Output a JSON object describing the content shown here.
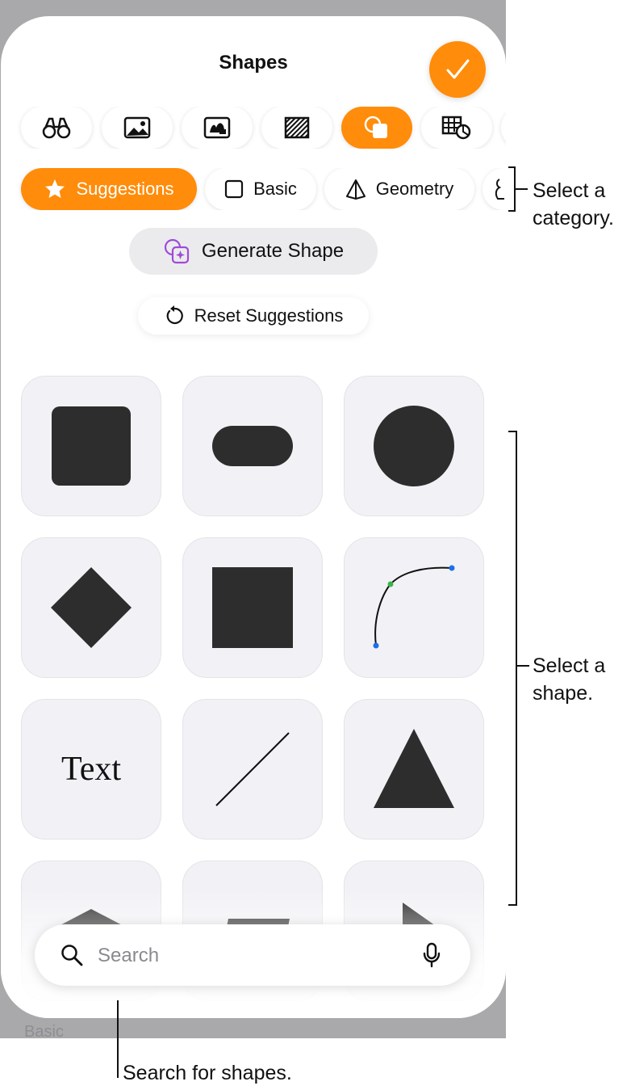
{
  "sheet": {
    "title": "Shapes",
    "done_icon": "checkmark-icon",
    "accent_color": "#ff8c0a"
  },
  "tabs": [
    {
      "icon": "binoculars-icon",
      "active": false
    },
    {
      "icon": "photo-icon",
      "active": false
    },
    {
      "icon": "image-gallery-icon",
      "active": false
    },
    {
      "icon": "hatched-pattern-icon",
      "active": false
    },
    {
      "icon": "shapes-icon",
      "active": true
    },
    {
      "icon": "table-chart-icon",
      "active": false
    }
  ],
  "categories": [
    {
      "label": "Suggestions",
      "icon": "star-icon",
      "active": true
    },
    {
      "label": "Basic",
      "icon": "square-outline-icon",
      "active": false
    },
    {
      "label": "Geometry",
      "icon": "pyramid-icon",
      "active": false
    }
  ],
  "generate_button": {
    "label": "Generate Shape",
    "icon": "sparkle-shape-icon"
  },
  "reset_button": {
    "label": "Reset Suggestions",
    "icon": "reset-icon"
  },
  "shapes": [
    {
      "name": "rounded-square"
    },
    {
      "name": "pill"
    },
    {
      "name": "circle"
    },
    {
      "name": "diamond"
    },
    {
      "name": "square"
    },
    {
      "name": "curve"
    },
    {
      "name": "text",
      "label": "Text"
    },
    {
      "name": "line"
    },
    {
      "name": "triangle"
    },
    {
      "name": "pentagon"
    },
    {
      "name": "parallelogram"
    },
    {
      "name": "arrow"
    }
  ],
  "search": {
    "placeholder": "Search"
  },
  "ghost_label": "Basic",
  "callouts": {
    "category": "Select a\ncategory.",
    "shape": "Select a\nshape.",
    "search": "Search for shapes."
  }
}
